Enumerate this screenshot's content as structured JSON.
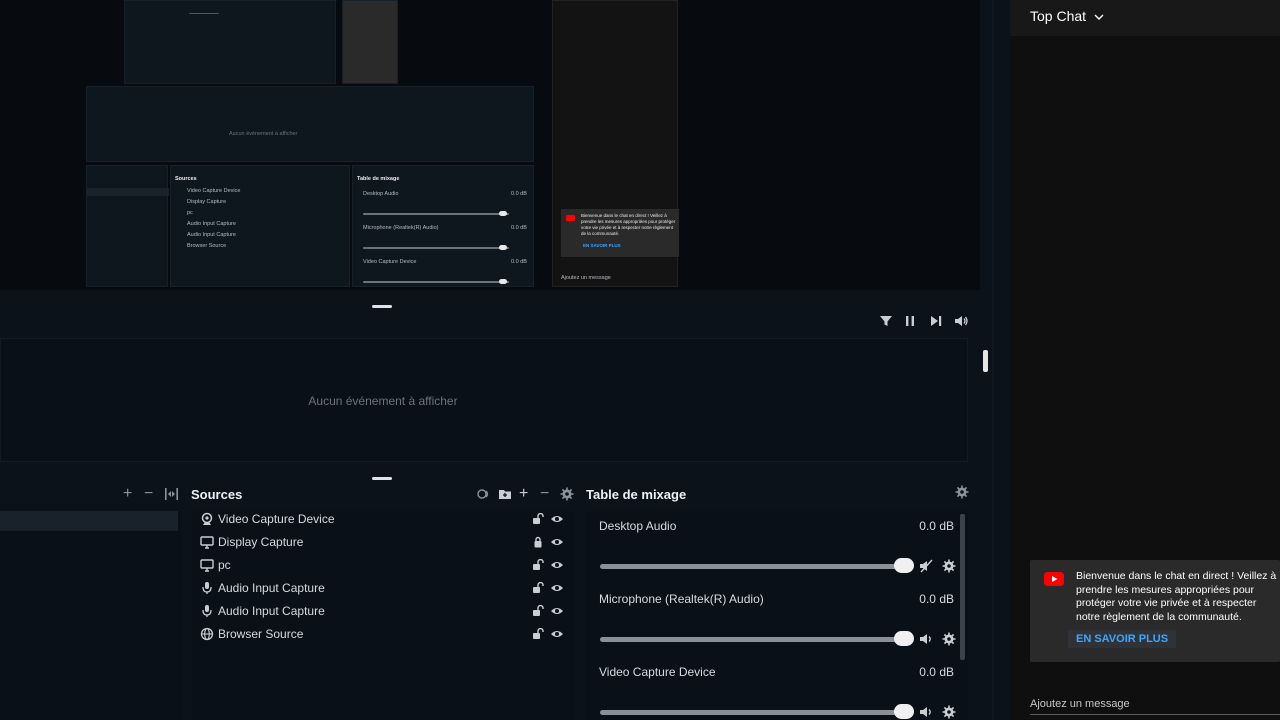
{
  "preview": {
    "mini": {
      "log_empty": "Aucun événement à afficher",
      "sources_title": "Sources",
      "mixer_title": "Table de mixage",
      "sources": [
        "Video Capture Device",
        "Display Capture",
        "pc",
        "Audio Input Capture",
        "Audio Input Capture",
        "Browser Source"
      ],
      "channels": [
        {
          "name": "Desktop Audio",
          "db": "0.0 dB"
        },
        {
          "name": "Microphone (Realtek(R) Audio)",
          "db": "0.0 dB"
        },
        {
          "name": "Video Capture Device",
          "db": "0.0 dB"
        }
      ],
      "chat_card_text": "Bienvenue dans le chat en direct ! Veillez à prendre les mesures appropriées pour protéger votre vie privée et à respecter notre règlement de la communauté.",
      "chat_card_link": "EN SAVOIR PLUS",
      "chat_input": "Ajoutez un message"
    }
  },
  "log": {
    "empty_text": "Aucun événement à afficher",
    "toolbar_icons": [
      "filter-icon",
      "pause-icon",
      "skip-forward-icon",
      "volume-icon"
    ]
  },
  "scenes": {
    "controls": [
      "+",
      "−",
      "|◂▸|"
    ]
  },
  "sources": {
    "title": "Sources",
    "items": [
      {
        "label": "Video Capture Device",
        "icon": "camera-icon",
        "locked": false
      },
      {
        "label": "Display Capture",
        "icon": "monitor-icon",
        "locked": true
      },
      {
        "label": "pc",
        "icon": "monitor-icon",
        "locked": false
      },
      {
        "label": "Audio Input Capture",
        "icon": "microphone-icon",
        "locked": false
      },
      {
        "label": "Audio Input Capture",
        "icon": "microphone-icon",
        "locked": false
      },
      {
        "label": "Browser Source",
        "icon": "globe-icon",
        "locked": false
      }
    ]
  },
  "mixer": {
    "title": "Table de mixage",
    "channels": [
      {
        "name": "Desktop Audio",
        "db": "0.0 dB",
        "muted": true,
        "level": 1.0
      },
      {
        "name": "Microphone (Realtek(R) Audio)",
        "db": "0.0 dB",
        "muted": false,
        "level": 1.0
      },
      {
        "name": "Video Capture Device",
        "db": "0.0 dB",
        "muted": false,
        "level": 1.0
      }
    ]
  },
  "chat": {
    "title": "Top Chat",
    "card_text": "Bienvenue dans le chat en direct ! Veillez à prendre les mesures appropriées pour protéger votre vie privée et à respecter notre règlement de la communauté.",
    "card_link": "EN SAVOIR PLUS",
    "input_placeholder": "Ajoutez un message",
    "accent": "#3ea6ff",
    "brand_red": "#ff0000"
  }
}
